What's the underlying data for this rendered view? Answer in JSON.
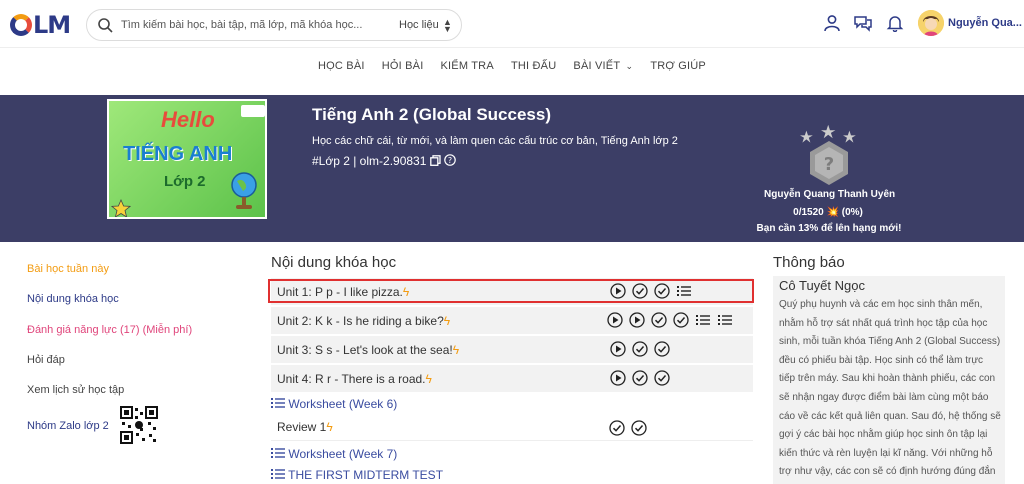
{
  "header": {
    "logo": "OLM",
    "search_placeholder": "Tìm kiếm bài học, bài tập, mã lớp, mã khóa học...",
    "search_scope": "Học liệu",
    "username": "Nguyễn Qua..."
  },
  "nav": {
    "items": [
      "HỌC BÀI",
      "HỎI BÀI",
      "KIỂM TRA",
      "THI ĐẤU",
      "BÀI VIẾT",
      "TRỢ GIÚP"
    ]
  },
  "course": {
    "cover_text_1": "Hello",
    "cover_text_2": "TIẾNG ANH",
    "cover_text_3": "Lớp 2",
    "title": "Tiếng Anh 2 (Global Success)",
    "description": "Học các chữ cái, từ mới, và làm quen các cấu trúc cơ bản, Tiếng Anh lớp 2",
    "code": "#Lớp 2 | olm-2.90831",
    "rank_name": "Nguyễn Quang Thanh Uyên",
    "rank_score": "0/1520 💥 (0%)",
    "rank_note": "Bạn cần 13% để lên hạng mới!"
  },
  "sidebar": {
    "items": [
      "Bài học tuần này",
      "Nội dung khóa học",
      "Đánh giá năng lực (17) (Miễn phí)",
      "Hỏi đáp",
      "Xem lịch sử học tập",
      "Nhóm Zalo lớp 2"
    ],
    "colors": {
      "active": "#f39c12",
      "current": "#2d3a87",
      "assessment": "#e0457b"
    }
  },
  "content": {
    "title": "Nội dung khóa học",
    "units": [
      {
        "label": "Unit 1: P p - I like pizza.",
        "icons": [
          "play",
          "check",
          "check",
          "list"
        ]
      },
      {
        "label": "Unit 2: K k - Is he riding a bike?",
        "icons": [
          "play",
          "play",
          "check",
          "check",
          "list",
          "list"
        ]
      },
      {
        "label": "Unit 3: S s - Let's look at the sea!",
        "icons": [
          "play",
          "check",
          "check"
        ]
      },
      {
        "label": "Unit 4: R r - There is a road.",
        "icons": [
          "play",
          "check",
          "check"
        ]
      }
    ],
    "worksheet_6": "Worksheet (Week 6)",
    "review": "Review 1",
    "worksheet_7": "Worksheet (Week 7)",
    "midterm": "THE FIRST MIDTERM TEST"
  },
  "notices": {
    "title": "Thông báo",
    "author": "Cô Tuyết Ngọc",
    "text": "Quý phụ huynh và các em học sinh thân mến, nhằm hỗ trợ sát nhất quá trình học tập của học sinh, mỗi tuần khóa Tiếng Anh 2 (Global Success) đều có phiếu bài tập. Học sinh có thể làm trực tiếp trên máy. Sau khi hoàn thành phiếu, các con sẽ nhận ngay được điểm bài làm cùng một báo cáo về các kết quả liên quan. Sau đó, hệ thống sẽ gợi ý các bài học nhằm giúp học sinh ôn tập lại kiến thức và rèn luyện lại kĩ năng. Với những hỗ trợ như vậy, các con sẽ có định hướng đúng đắn và nâng cao được kết quả học tập."
  }
}
